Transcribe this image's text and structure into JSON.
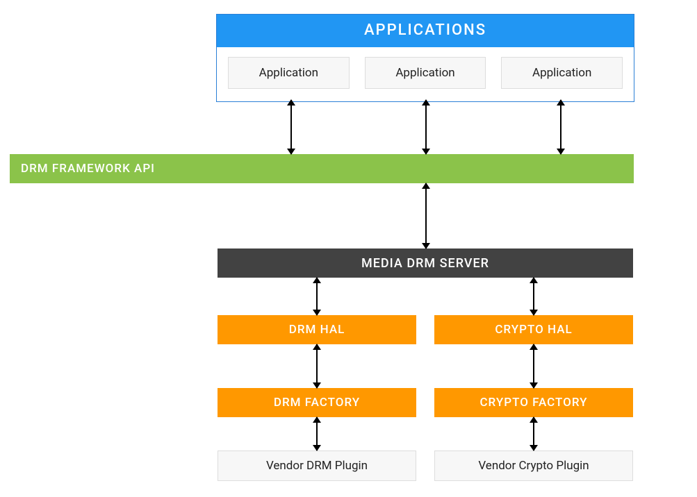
{
  "applications": {
    "header": "APPLICATIONS",
    "items": [
      "Application",
      "Application",
      "Application"
    ]
  },
  "api_bar": "DRM FRAMEWORK API",
  "server_bar": "MEDIA DRM SERVER",
  "drm_hal": "DRM HAL",
  "crypto_hal": "CRYPTO HAL",
  "drm_factory": "DRM FACTORY",
  "crypto_factory": "CRYPTO FACTORY",
  "vendor_drm": "Vendor DRM Plugin",
  "vendor_crypto": "Vendor Crypto Plugin"
}
